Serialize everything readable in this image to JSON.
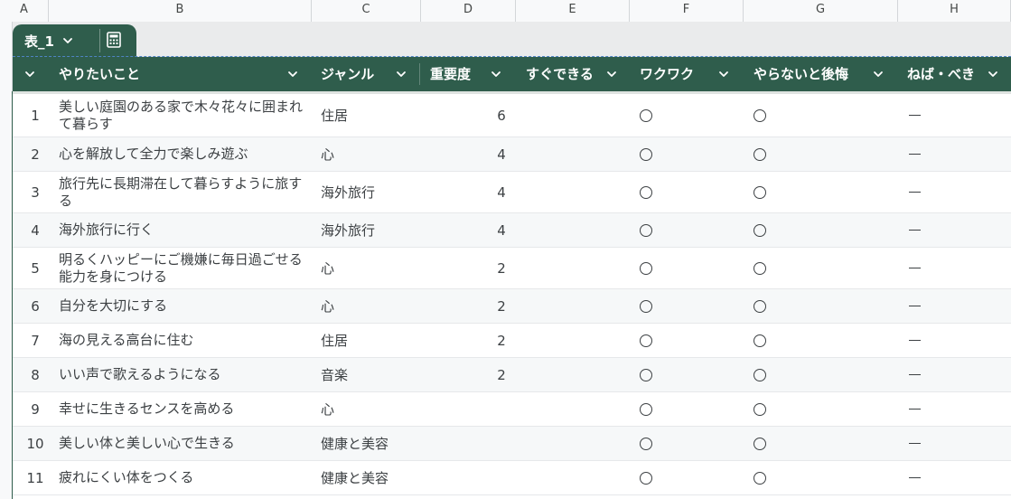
{
  "column_letters": [
    "A",
    "B",
    "C",
    "D",
    "E",
    "F",
    "G",
    "H"
  ],
  "table": {
    "name": "表_1",
    "headers": [
      "やりたいこと",
      "ジャンル",
      "重要度",
      "すぐできる",
      "ワクワク",
      "やらないと後悔",
      "ねば・べき"
    ]
  },
  "rows": [
    {
      "num": "1",
      "task": "美しい庭園のある家で木々花々に囲まれて暮らす",
      "genre": "住居",
      "importance": "6",
      "soon": "",
      "excite": "〇",
      "regret": "〇",
      "must": "—"
    },
    {
      "num": "2",
      "task": "心を解放して全力で楽しみ遊ぶ",
      "genre": "心",
      "importance": "4",
      "soon": "",
      "excite": "〇",
      "regret": "〇",
      "must": "—"
    },
    {
      "num": "3",
      "task": "旅行先に長期滞在して暮らすように旅する",
      "genre": "海外旅行",
      "importance": "4",
      "soon": "",
      "excite": "〇",
      "regret": "〇",
      "must": "—"
    },
    {
      "num": "4",
      "task": "海外旅行に行く",
      "genre": "海外旅行",
      "importance": "4",
      "soon": "",
      "excite": "〇",
      "regret": "〇",
      "must": "—"
    },
    {
      "num": "5",
      "task": "明るくハッピーにご機嫌に毎日過ごせる能力を身につける",
      "genre": "心",
      "importance": "2",
      "soon": "",
      "excite": "〇",
      "regret": "〇",
      "must": "—"
    },
    {
      "num": "6",
      "task": "自分を大切にする",
      "genre": "心",
      "importance": "2",
      "soon": "",
      "excite": "〇",
      "regret": "〇",
      "must": "—"
    },
    {
      "num": "7",
      "task": "海の見える高台に住む",
      "genre": "住居",
      "importance": "2",
      "soon": "",
      "excite": "〇",
      "regret": "〇",
      "must": "—"
    },
    {
      "num": "8",
      "task": "いい声で歌えるようになる",
      "genre": "音楽",
      "importance": "2",
      "soon": "",
      "excite": "〇",
      "regret": "〇",
      "must": "—"
    },
    {
      "num": "9",
      "task": "幸せに生きるセンスを高める",
      "genre": "心",
      "importance": "",
      "soon": "",
      "excite": "〇",
      "regret": "〇",
      "must": "—"
    },
    {
      "num": "10",
      "task": "美しい体と美しい心で生きる",
      "genre": "健康と美容",
      "importance": "",
      "soon": "",
      "excite": "〇",
      "regret": "〇",
      "must": "—"
    },
    {
      "num": "11",
      "task": "疲れにくい体をつくる",
      "genre": "健康と美容",
      "importance": "",
      "soon": "",
      "excite": "〇",
      "regret": "〇",
      "must": "—"
    }
  ]
}
